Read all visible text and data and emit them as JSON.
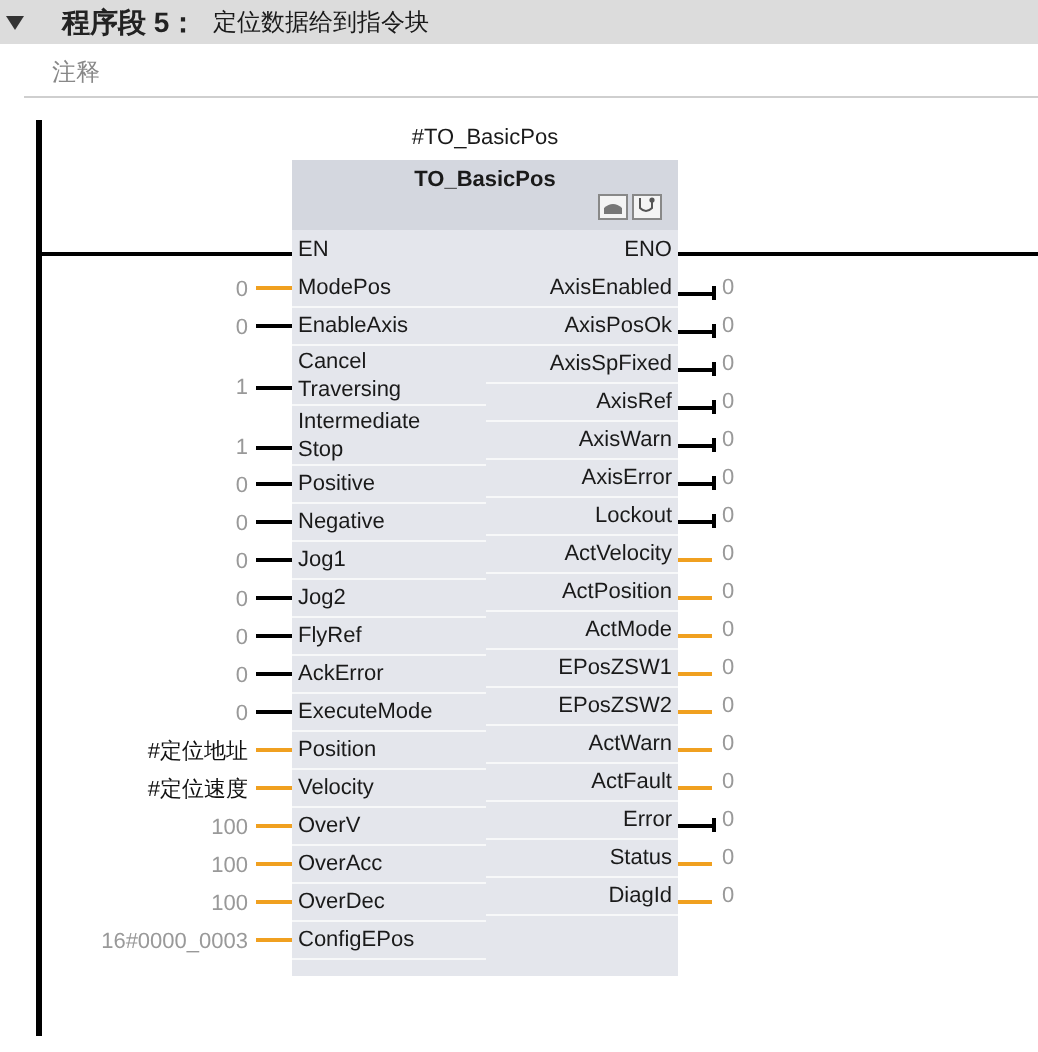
{
  "network": {
    "expanded": true,
    "label": "程序段 5：",
    "title": "定位数据给到指令块",
    "comment": "注释"
  },
  "block": {
    "instance": "#TO_BasicPos",
    "type": "TO_BasicPos",
    "en": "EN",
    "eno": "ENO",
    "inputs": [
      {
        "name": "ModePos",
        "kind": "value",
        "operand": "0",
        "constant": true
      },
      {
        "name": "EnableAxis",
        "kind": "bool",
        "operand": "0",
        "constant": true
      },
      {
        "name": "Cancel Traversing",
        "kind": "bool",
        "operand": "1",
        "constant": true
      },
      {
        "name": "Intermediate Stop",
        "kind": "bool",
        "operand": "1",
        "constant": true
      },
      {
        "name": "Positive",
        "kind": "bool",
        "operand": "0",
        "constant": true
      },
      {
        "name": "Negative",
        "kind": "bool",
        "operand": "0",
        "constant": true
      },
      {
        "name": "Jog1",
        "kind": "bool",
        "operand": "0",
        "constant": true
      },
      {
        "name": "Jog2",
        "kind": "bool",
        "operand": "0",
        "constant": true
      },
      {
        "name": "FlyRef",
        "kind": "bool",
        "operand": "0",
        "constant": true
      },
      {
        "name": "AckError",
        "kind": "bool",
        "operand": "0",
        "constant": true
      },
      {
        "name": "ExecuteMode",
        "kind": "bool",
        "operand": "0",
        "constant": true
      },
      {
        "name": "Position",
        "kind": "value",
        "operand": "#定位地址",
        "constant": false
      },
      {
        "name": "Velocity",
        "kind": "value",
        "operand": "#定位速度",
        "constant": false
      },
      {
        "name": "OverV",
        "kind": "value",
        "operand": "100",
        "constant": true
      },
      {
        "name": "OverAcc",
        "kind": "value",
        "operand": "100",
        "constant": true
      },
      {
        "name": "OverDec",
        "kind": "value",
        "operand": "100",
        "constant": true
      },
      {
        "name": "ConfigEPos",
        "kind": "value",
        "operand": "16#0000_0003",
        "constant": true
      }
    ],
    "outputs": [
      {
        "name": "AxisEnabled",
        "kind": "bool",
        "operand": "0"
      },
      {
        "name": "AxisPosOk",
        "kind": "bool",
        "operand": "0"
      },
      {
        "name": "AxisSpFixed",
        "kind": "bool",
        "operand": "0"
      },
      {
        "name": "AxisRef",
        "kind": "bool",
        "operand": "0"
      },
      {
        "name": "AxisWarn",
        "kind": "bool",
        "operand": "0"
      },
      {
        "name": "AxisError",
        "kind": "bool",
        "operand": "0"
      },
      {
        "name": "Lockout",
        "kind": "bool",
        "operand": "0"
      },
      {
        "name": "ActVelocity",
        "kind": "value",
        "operand": "0"
      },
      {
        "name": "ActPosition",
        "kind": "value",
        "operand": "0"
      },
      {
        "name": "ActMode",
        "kind": "value",
        "operand": "0"
      },
      {
        "name": "EPosZSW1",
        "kind": "value",
        "operand": "0"
      },
      {
        "name": "EPosZSW2",
        "kind": "value",
        "operand": "0"
      },
      {
        "name": "ActWarn",
        "kind": "value",
        "operand": "0"
      },
      {
        "name": "ActFault",
        "kind": "value",
        "operand": "0"
      },
      {
        "name": "Error",
        "kind": "bool",
        "operand": "0"
      },
      {
        "name": "Status",
        "kind": "value",
        "operand": "0"
      },
      {
        "name": "DiagId",
        "kind": "value",
        "operand": "0"
      }
    ]
  }
}
